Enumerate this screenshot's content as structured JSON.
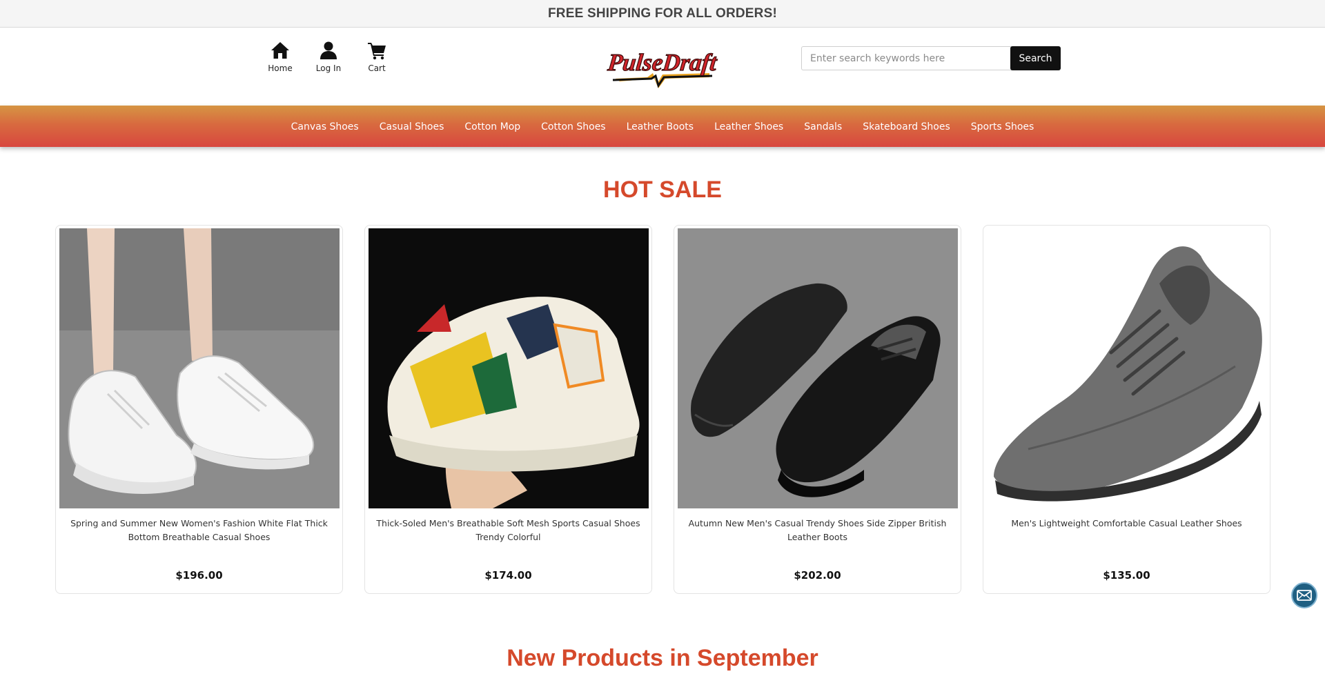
{
  "announcement": "FREE SHIPPING FOR ALL ORDERS!",
  "quicknav": {
    "home": "Home",
    "login": "Log In",
    "cart": "Cart"
  },
  "brand": "PulseDraft",
  "search": {
    "placeholder": "Enter search keywords here",
    "button": "Search"
  },
  "categories": [
    "Canvas Shoes",
    "Casual Shoes",
    "Cotton Mop",
    "Cotton Shoes",
    "Leather Boots",
    "Leather Shoes",
    "Sandals",
    "Skateboard Shoes",
    "Sports Shoes"
  ],
  "hot_sale": {
    "title": "HOT SALE",
    "products": [
      {
        "name": "Spring and Summer New Women's Fashion White Flat Thick Bottom Breathable Casual Shoes",
        "price": "$196.00"
      },
      {
        "name": "Thick-Soled Men's Breathable Soft Mesh Sports Casual Shoes Trendy Colorful",
        "price": "$174.00"
      },
      {
        "name": "Autumn New Men's Casual Trendy Shoes Side Zipper British Leather Boots",
        "price": "$202.00"
      },
      {
        "name": "Men's Lightweight Comfortable Casual Leather Shoes",
        "price": "$135.00"
      }
    ]
  },
  "new_products": {
    "title": "New Products in September"
  },
  "colors": {
    "accent": "#d5492b",
    "nav_top": "#d69543",
    "nav_bottom": "#d8473f",
    "button": "#111111"
  },
  "icons": {
    "home": "home-icon",
    "login": "user-icon",
    "cart": "cart-icon",
    "mail": "mail-icon"
  }
}
